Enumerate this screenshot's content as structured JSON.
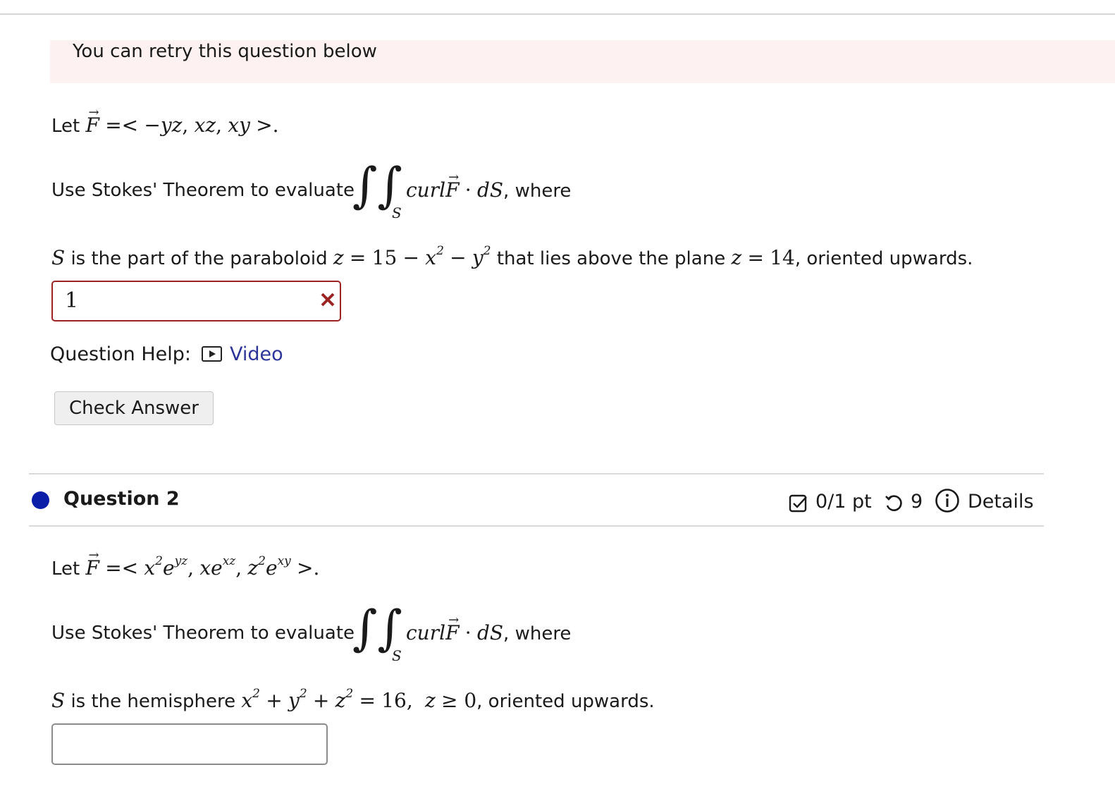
{
  "retry_banner": "You can retry this question below",
  "q1": {
    "let_prefix": "Let",
    "field_components": [
      "−yz",
      "xz",
      "xy"
    ],
    "stokes_text": "Use Stokes' Theorem to evaluate",
    "integrand": "curl",
    "dS": "dS",
    "where": ", where",
    "surface_sub": "S",
    "surface_text_1": "is the part of the paraboloid",
    "paraboloid_const": "15",
    "surface_text_2": "that lies above the plane",
    "plane_value": "14",
    "surface_text_3": ", oriented upwards.",
    "answer_value": "1",
    "wrong_mark": "×",
    "question_help_label": "Question Help:",
    "video_label": "Video",
    "check_answer_label": "Check Answer"
  },
  "q2": {
    "title": "Question 2",
    "points": "0/1 pt",
    "retries": "9",
    "details_label": "Details",
    "let_prefix": "Let",
    "stokes_text": "Use Stokes' Theorem to evaluate",
    "integrand": "curl",
    "dS": "dS",
    "where": ", where",
    "surface_sub": "S",
    "surface_text_1": "is the hemisphere",
    "radius_sq": "16",
    "surface_text_2": ", oriented upwards.",
    "answer_value": ""
  },
  "colors": {
    "banner_bg": "#fdf2f1",
    "error_border": "#9b2423",
    "link": "#2b3499",
    "question_dot": "#0a1ea8"
  },
  "icons": [
    "video-icon",
    "close-icon",
    "checkbox-icon",
    "retry-icon",
    "info-icon"
  ]
}
